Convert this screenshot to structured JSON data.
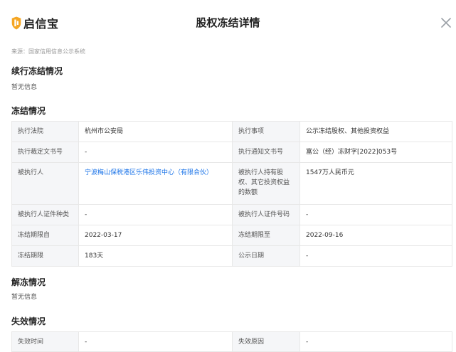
{
  "header": {
    "logo_text": "启信宝",
    "title": "股权冻结详情"
  },
  "source": "来源：国家信用信息公示系统",
  "sections": {
    "continued_freeze": {
      "title": "续行冻结情况",
      "empty_text": "暂无信息"
    },
    "freeze": {
      "title": "冻结情况",
      "rows": [
        {
          "l1": "执行法院",
          "v1": "杭州市公安局",
          "l2": "执行事项",
          "v2": "公示冻结股权、其他投资权益"
        },
        {
          "l1": "执行裁定文书号",
          "v1": "-",
          "l2": "执行通知文书号",
          "v2": "富公（经）冻财字[2022]053号"
        },
        {
          "l1": "被执行人",
          "v1": "宁波梅山保税港区乐伟投资中心（有限合伙）",
          "l2": "被执行人持有股权、其它投资权益的数额",
          "v2": "1547万人民币元"
        },
        {
          "l1": "被执行人证件种类",
          "v1": "-",
          "l2": "被执行人证件号码",
          "v2": "-"
        },
        {
          "l1": "冻结期限自",
          "v1": "2022-03-17",
          "l2": "冻结期限至",
          "v2": "2022-09-16"
        },
        {
          "l1": "冻结期限",
          "v1": "183天",
          "l2": "公示日期",
          "v2": "-"
        }
      ]
    },
    "unfreeze": {
      "title": "解冻情况",
      "empty_text": "暂无信息"
    },
    "invalid": {
      "title": "失效情况",
      "rows": [
        {
          "l1": "失效时间",
          "v1": "-",
          "l2": "失效原因",
          "v2": "-"
        }
      ]
    }
  },
  "colors": {
    "link": "#1a73e8",
    "logo_accent": "#f5a623",
    "label_bg": "#f5f6f8"
  }
}
